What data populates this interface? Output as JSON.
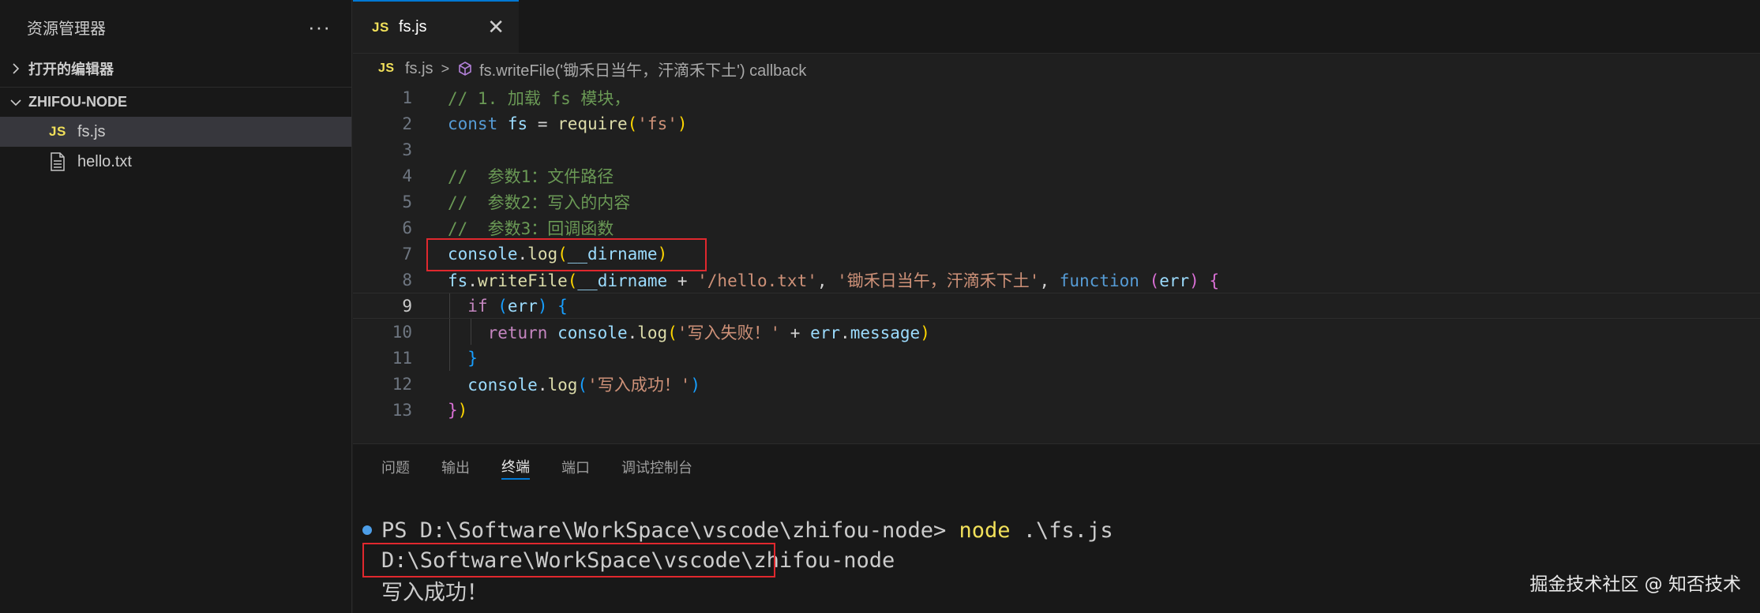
{
  "sidebar": {
    "title": "资源管理器",
    "more": "···",
    "sections": {
      "open_editors": "打开的编辑器",
      "project": "ZHIFOU-NODE"
    },
    "files": [
      {
        "badge": "JS",
        "name": "fs.js"
      },
      {
        "name": "hello.txt"
      }
    ]
  },
  "editor": {
    "tab": {
      "badge": "JS",
      "label": "fs.js",
      "close": "✕"
    },
    "breadcrumb": {
      "badge": "JS",
      "file": "fs.js",
      "symbol": "fs.writeFile('锄禾日当午，汗滴禾下土') callback"
    },
    "line_numbers": [
      "1",
      "2",
      "3",
      "4",
      "5",
      "6",
      "7",
      "8",
      "9",
      "10",
      "11",
      "12",
      "13"
    ],
    "current_line": 9,
    "code": {
      "l1_comment": "// 1. 加载 fs 模块，",
      "l2_const": "const",
      "l2_fs": "fs",
      "l2_eq": " = ",
      "l2_require": "require",
      "l2_arg": "'fs'",
      "l4": "//  参数1：文件路径",
      "l5": "//  参数2：写入的内容",
      "l6": "//  参数3：回调函数",
      "l7_obj": "console",
      "l7_fn": "log",
      "l7_arg": "__dirname",
      "l8_obj": "fs",
      "l8_fn": "writeFile",
      "l8_arg1": "__dirname",
      "l8_plus": " + ",
      "l8_str1": "'/hello.txt'",
      "l8_str2": "'锄禾日当午，汗滴禾下土'",
      "l8_function": "function",
      "l8_param": "err",
      "l9_if": "if",
      "l9_param": "err",
      "l10_return": "return",
      "l10_obj": "console",
      "l10_fn": "log",
      "l10_str": "'写入失败！'",
      "l10_plus": " + ",
      "l10_err": "err",
      "l10_prop": "message",
      "l12_obj": "console",
      "l12_fn": "log",
      "l12_str": "'写入成功！'"
    }
  },
  "panel": {
    "tabs": [
      "问题",
      "输出",
      "终端",
      "端口",
      "调试控制台"
    ],
    "active_tab": "终端",
    "terminal": {
      "prompt": "PS D:\\Software\\WorkSpace\\vscode\\zhifou-node> ",
      "command": "node",
      "command_arg": " .\\fs.js",
      "output1": "D:\\Software\\WorkSpace\\vscode\\zhifou-node",
      "output2": "写入成功！"
    }
  },
  "watermark": "掘金技术社区 @ 知否技术",
  "colors": {
    "accent": "#0078d4",
    "highlight_box": "#e0282e",
    "js_badge": "#f1e05a"
  }
}
